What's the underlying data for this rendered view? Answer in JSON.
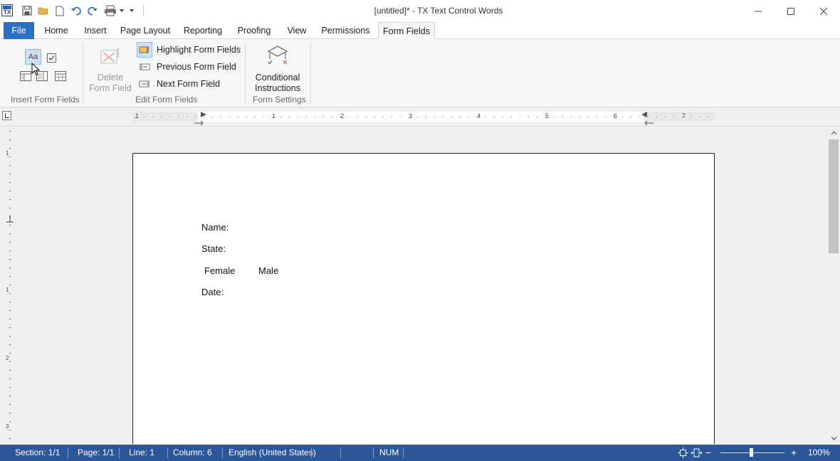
{
  "window": {
    "title": "[untitled]* - TX Text Control Words",
    "app_icon_text": "TX"
  },
  "quick_access": [
    {
      "name": "save",
      "icon": "save-icon"
    },
    {
      "name": "open",
      "icon": "folder-open-icon"
    },
    {
      "name": "new",
      "icon": "new-document-icon"
    },
    {
      "name": "undo",
      "icon": "undo-icon"
    },
    {
      "name": "redo",
      "icon": "redo-icon"
    },
    {
      "name": "print",
      "icon": "printer-icon"
    }
  ],
  "tabs": {
    "file": "File",
    "home": "Home",
    "insert": "Insert",
    "page_layout": "Page Layout",
    "reporting": "Reporting",
    "proofing": "Proofing",
    "view": "View",
    "permissions": "Permissions",
    "form_fields": "Form Fields"
  },
  "ribbon": {
    "insert_form_fields": {
      "label": "Insert Form Fields",
      "text_field_icon_text": "Aa"
    },
    "edit_form_fields": {
      "label": "Edit Form Fields",
      "delete_line1": "Delete",
      "delete_line2": "Form Field",
      "highlight": "Highlight Form Fields",
      "previous": "Previous Form Field",
      "next": "Next Form Field"
    },
    "form_settings": {
      "label": "Form Settings",
      "conditional_line1": "Conditional",
      "conditional_line2": "Instructions"
    }
  },
  "ruler": {
    "h_numbers": [
      "1",
      "1",
      "2",
      "3",
      "4",
      "5",
      "6",
      "7"
    ],
    "v_numbers": [
      "1",
      "1",
      "2",
      "3"
    ]
  },
  "document": {
    "lines": {
      "name": "Name:",
      "state": "State:",
      "female": "Female",
      "male": "Male",
      "date": "Date:"
    }
  },
  "statusbar": {
    "section": "Section: 1/1",
    "page": "Page: 1/1",
    "line": "Line: 1",
    "column": "Column: 6",
    "language": "English (United States)",
    "num": "NUM",
    "zoom": "100%",
    "zoom_out": "−",
    "zoom_in": "+"
  },
  "colors": {
    "accent": "#2b6fc4",
    "statusbar": "#2b579a"
  }
}
